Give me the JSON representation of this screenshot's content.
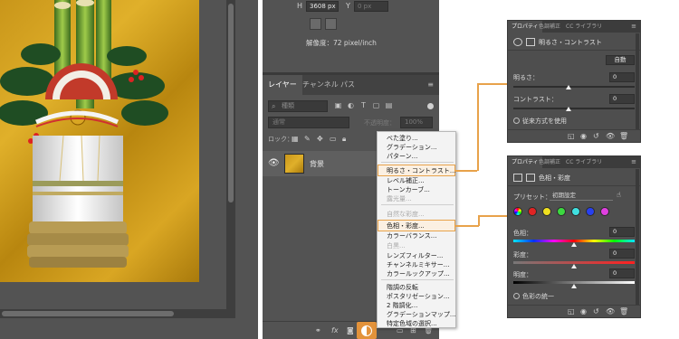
{
  "properties_top": {
    "h_label": "H",
    "h_value": "3608 px",
    "y_label": "Y",
    "y_placeholder": "0 px",
    "resolution": "解像度：72 pixel/inch"
  },
  "layers_panel": {
    "tabs": [
      {
        "label": "レイヤー",
        "active": true
      },
      {
        "label": "チャンネル",
        "active": false
      },
      {
        "label": "パス",
        "active": false
      }
    ],
    "search_placeholder": "種類",
    "blend_mode": "通常",
    "opacity_label": "不透明度：",
    "opacity_value": "100%",
    "lock_label": "ロック：",
    "layer": {
      "name": "背景"
    }
  },
  "adjustment_menu": {
    "groups": [
      [
        "べた塗り...",
        "グラデーション...",
        "パターン..."
      ],
      [
        "明るさ・コントラスト...",
        "レベル補正...",
        "トーンカーブ...",
        "露光量..."
      ],
      [
        "自然な彩度...",
        "色相・彩度...",
        "カラーバランス...",
        "白黒...",
        "レンズフィルター...",
        "チャンネルミキサー...",
        "カラールックアップ..."
      ],
      [
        "階調の反転",
        "ポスタリゼーション...",
        "2 階調化...",
        "グラデーションマップ...",
        "特定色域の選択..."
      ]
    ],
    "highlighted": [
      "明るさ・コントラスト...",
      "色相・彩度..."
    ],
    "disabled": [
      "自然な彩度...",
      "白黒...",
      "露光量..."
    ]
  },
  "brightness_panel": {
    "tabs": [
      {
        "label": "プロパティ",
        "active": true
      },
      {
        "label": "色調補正",
        "active": false
      },
      {
        "label": "CC ライブラリ",
        "active": false
      }
    ],
    "title": "明るさ・コントラスト",
    "auto_button": "自動",
    "brightness_label": "明るさ：",
    "brightness_value": "0",
    "contrast_label": "コントラスト：",
    "contrast_value": "0",
    "legacy_label": "従来方式を使用"
  },
  "huesat_panel": {
    "tabs": [
      {
        "label": "プロパティ",
        "active": true
      },
      {
        "label": "色調補正",
        "active": false
      },
      {
        "label": "CC ライブラリ",
        "active": false
      }
    ],
    "title": "色相・彩度",
    "preset_label": "プリセット：",
    "preset_value": "初期設定",
    "hue_label": "色相：",
    "hue_value": "0",
    "saturation_label": "彩度：",
    "saturation_value": "0",
    "lightness_label": "明度：",
    "lightness_value": "0",
    "colorize_label": "色彩の統一",
    "swatches": [
      "#e02424",
      "#f0e020",
      "#3cd840",
      "#40e0e0",
      "#2840f0",
      "#e040e0"
    ]
  },
  "colors": {
    "accent": "#e8a24a",
    "panel_bg": "#535353",
    "menu_bg": "#f3f3f3"
  }
}
